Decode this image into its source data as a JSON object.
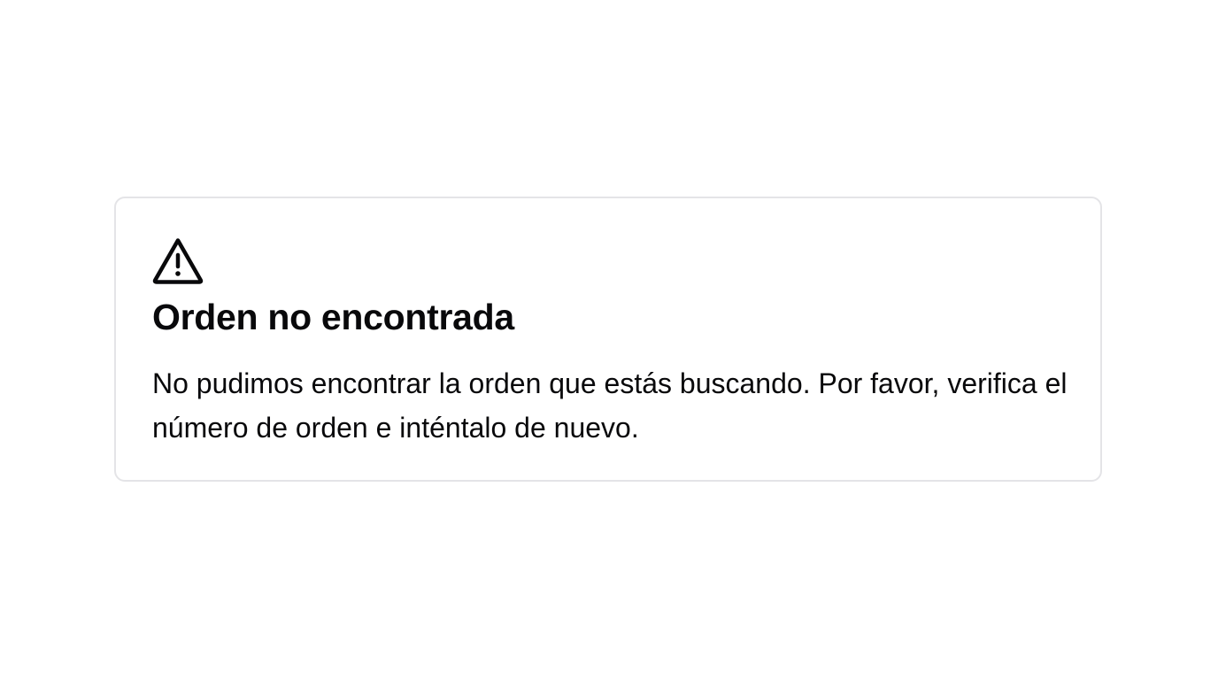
{
  "alert": {
    "icon": "warning-triangle-icon",
    "title": "Orden no encontrada",
    "description": "No pudimos encontrar la orden que estás buscando. Por favor, verifica el número de orden e inténtalo de nuevo."
  },
  "colors": {
    "text": "#09090b",
    "border": "#e4e4e7",
    "background": "#ffffff"
  }
}
